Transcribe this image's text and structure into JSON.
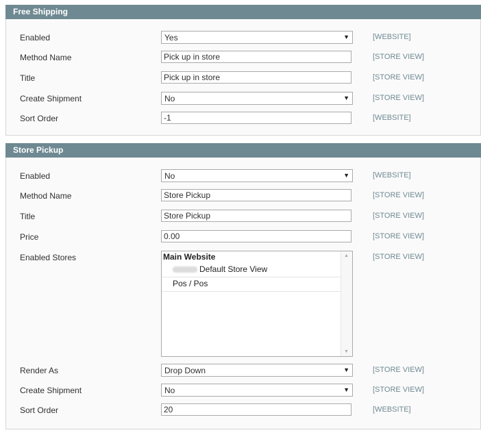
{
  "free_shipping": {
    "title": "Free Shipping",
    "rows": {
      "enabled": {
        "label": "Enabled",
        "value": "Yes",
        "scope": "[WEBSITE]"
      },
      "method_name": {
        "label": "Method Name",
        "value": "Pick up in store",
        "scope": "[STORE VIEW]"
      },
      "title": {
        "label": "Title",
        "value": "Pick up in store",
        "scope": "[STORE VIEW]"
      },
      "create_shipment": {
        "label": "Create Shipment",
        "value": "No",
        "scope": "[STORE VIEW]"
      },
      "sort_order": {
        "label": "Sort Order",
        "value": "-1",
        "scope": "[WEBSITE]"
      }
    }
  },
  "store_pickup": {
    "title": "Store Pickup",
    "rows": {
      "enabled": {
        "label": "Enabled",
        "value": "No",
        "scope": "[WEBSITE]"
      },
      "method_name": {
        "label": "Method Name",
        "value": "Store Pickup",
        "scope": "[STORE VIEW]"
      },
      "title": {
        "label": "Title",
        "value": "Store Pickup",
        "scope": "[STORE VIEW]"
      },
      "price": {
        "label": "Price",
        "value": "0.00",
        "scope": "[STORE VIEW]"
      },
      "enabled_stores": {
        "label": "Enabled Stores",
        "scope": "[STORE VIEW]",
        "group": "Main Website",
        "options": [
          "Default Store View",
          "Pos / Pos"
        ]
      },
      "render_as": {
        "label": "Render As",
        "value": "Drop Down",
        "scope": "[STORE VIEW]"
      },
      "create_shipment": {
        "label": "Create Shipment",
        "value": "No",
        "scope": "[STORE VIEW]"
      },
      "sort_order": {
        "label": "Sort Order",
        "value": "20",
        "scope": "[WEBSITE]"
      }
    }
  },
  "icons": {
    "dropdown": "chevron-down-icon",
    "scroll_up": "scroll-up-icon",
    "scroll_down": "scroll-down-icon"
  },
  "colors": {
    "header_bg": "#6f8992",
    "scope_text": "#6f8992",
    "panel_bg": "#fafafa"
  }
}
